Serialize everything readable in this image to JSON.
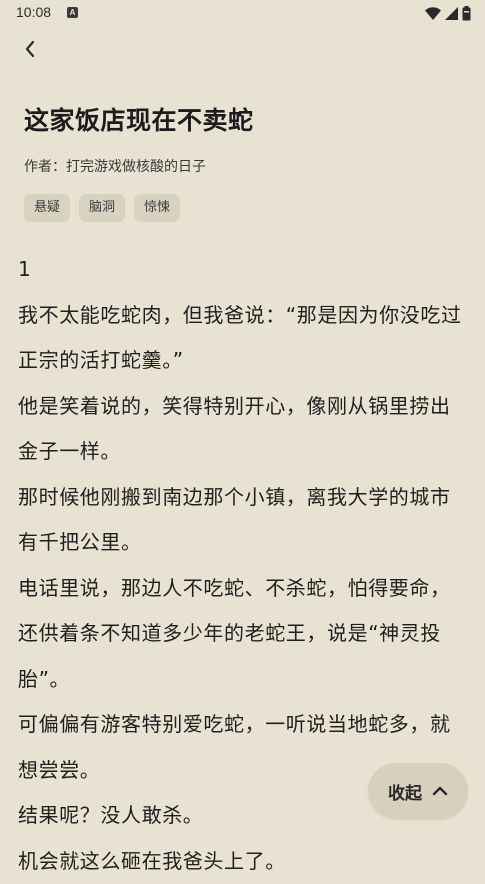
{
  "status_bar": {
    "time": "10:08",
    "notification_icon": "A"
  },
  "header": {
    "back_icon": "chevron-left-icon"
  },
  "story": {
    "title": "这家饭店现在不卖蛇",
    "author": "作者：打完游戏做核酸的日子",
    "tags": [
      "悬疑",
      "脑洞",
      "惊悚"
    ],
    "chapter": "1",
    "paragraphs": [
      "我不太能吃蛇肉，但我爸说：“那是因为你没吃过正宗的活打蛇羹。”",
      "他是笑着说的，笑得特别开心，像刚从锅里捞出金子一样。",
      "那时候他刚搬到南边那个小镇，离我大学的城市有千把公里。",
      "电话里说，那边人不吃蛇、不杀蛇，怕得要命，还供着条不知道多少年的老蛇王，说是“神灵投胎”。",
      "可偏偏有游客特别爱吃蛇，一听说当地蛇多，就想尝尝。",
      "结果呢？没人敢杀。",
      "机会就这么砸在我爸头上了。"
    ]
  },
  "collapse_button": {
    "label": "收起",
    "icon": "chevron-up-icon"
  }
}
